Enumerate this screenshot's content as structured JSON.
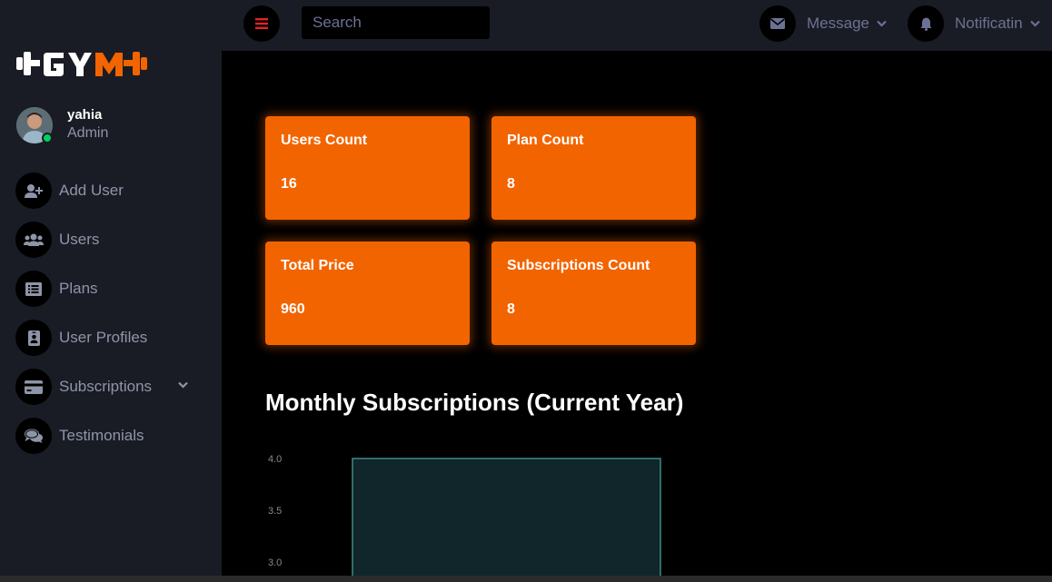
{
  "brand": {
    "logo_text": "GYM"
  },
  "profile": {
    "name": "yahia",
    "role": "Admin"
  },
  "sidebar": {
    "items": [
      {
        "label": "Add User",
        "icon": "user-plus-icon"
      },
      {
        "label": "Users",
        "icon": "users-icon"
      },
      {
        "label": "Plans",
        "icon": "list-icon"
      },
      {
        "label": "User Profiles",
        "icon": "id-badge-icon"
      },
      {
        "label": "Subscriptions",
        "icon": "credit-card-icon",
        "has_submenu": true
      },
      {
        "label": "Testimonials",
        "icon": "comments-icon"
      }
    ]
  },
  "topbar": {
    "search_placeholder": "Search",
    "message_label": "Message",
    "notification_label": "Notificatin"
  },
  "stats": [
    {
      "title": "Users Count",
      "value": "16"
    },
    {
      "title": "Plan Count",
      "value": "8"
    },
    {
      "title": "Total Price",
      "value": "960"
    },
    {
      "title": "Subscriptions Count",
      "value": "8"
    }
  ],
  "colors": {
    "accent": "#f26400",
    "sidebar_bg": "#191c24",
    "page_bg": "#000000",
    "bar_fill": "#10262a",
    "bar_stroke": "#3d8a85"
  },
  "chart_data": {
    "type": "bar",
    "title": "Monthly Subscriptions (Current Year)",
    "categories": [],
    "values": [
      4
    ],
    "yticks": [
      "4.0",
      "3.5",
      "3.0"
    ],
    "ylim": [
      3.0,
      4.0
    ]
  }
}
